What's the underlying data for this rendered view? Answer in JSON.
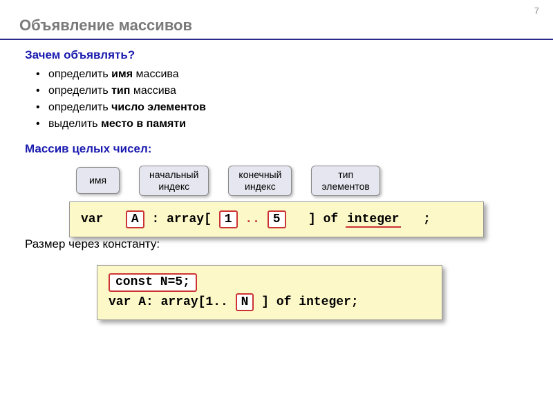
{
  "page_number": "7",
  "title": "Объявление массивов",
  "sections": {
    "why": {
      "head": "Зачем объявлять?",
      "items": [
        {
          "pre": "определить ",
          "bold": "имя",
          "post": " массива"
        },
        {
          "pre": "определить ",
          "bold": "тип",
          "post": " массива"
        },
        {
          "pre": "определить ",
          "bold": "число элементов",
          "post": ""
        },
        {
          "pre": "выделить ",
          "bold": "место в памяти",
          "post": ""
        }
      ]
    },
    "int_array": {
      "head": "Массив целых чисел:"
    },
    "labels": {
      "name": "имя",
      "start": "начальный\nиндекс",
      "end": "конечный\nиндекс",
      "type": "тип\nэлементов"
    },
    "code1": {
      "var": "var",
      "A": "A",
      "arr_open": ": array[",
      "one": "1",
      "dots": " .. ",
      "five": "5",
      "close": "] of ",
      "integer": "integer",
      "semi": ";"
    },
    "size_label": "Размер через константу:",
    "code2": {
      "const_line": "const N=5;",
      "var_pre": "var A: array[1..",
      "N": "N",
      "var_post": "] of integer;"
    }
  }
}
